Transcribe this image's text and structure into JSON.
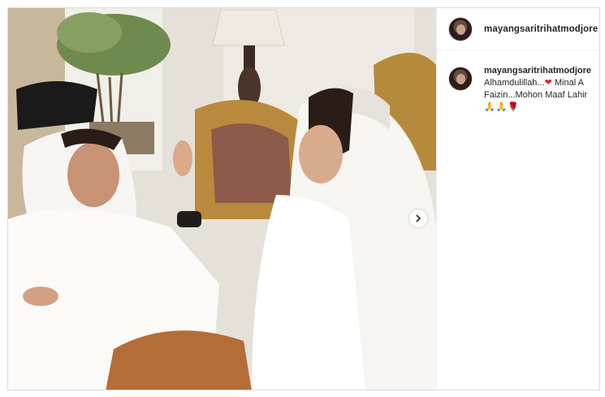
{
  "post": {
    "username": "mayangsaritrihatmodjore",
    "caption": {
      "username": "mayangsaritrihatmodjore",
      "line1_text": "Alhamdulillah...",
      "line1_emoji": "❤",
      "line1_suffix": " Minal A",
      "line2": "Faizin...Mohon Maaf Lahir",
      "line3_emoji": "🙏🙏🌹"
    }
  },
  "icons": {
    "carousel_next": "chevron-right-icon",
    "avatar": "profile-avatar"
  },
  "colors": {
    "text": "#262626",
    "border": "#dbdbdb",
    "heart": "#d62b3a"
  }
}
